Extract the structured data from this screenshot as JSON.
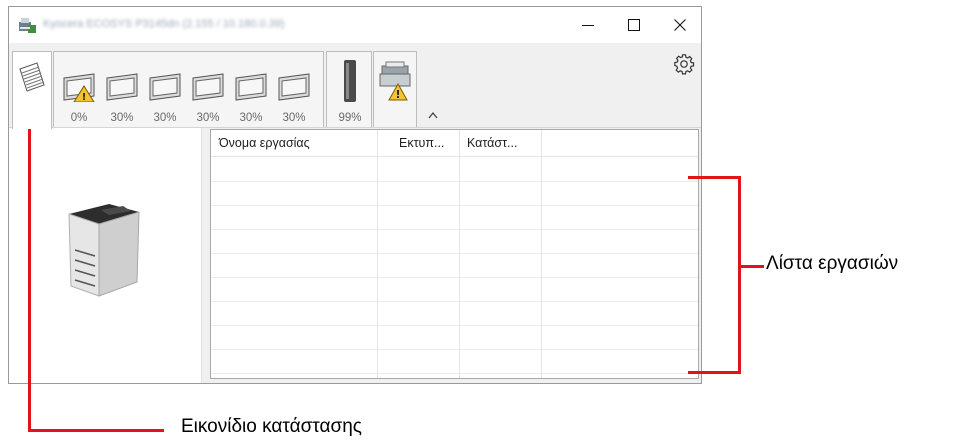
{
  "window": {
    "title_blurred": "Kyocera ECOSYS P3145dn (2.155 / 10.180.0.39)",
    "controls": {
      "minimize": "minimize",
      "maximize": "maximize",
      "close": "close"
    }
  },
  "toolbar": {
    "trays": [
      {
        "pct": "0%",
        "warning": true
      },
      {
        "pct": "30%",
        "warning": false
      },
      {
        "pct": "30%",
        "warning": false
      },
      {
        "pct": "30%",
        "warning": false
      },
      {
        "pct": "30%",
        "warning": false
      },
      {
        "pct": "30%",
        "warning": false
      }
    ],
    "toner": {
      "pct": "99%"
    },
    "colors": {
      "warning": "#f4c430",
      "tab_border": "#bdbdbd"
    }
  },
  "joblist": {
    "columns": [
      "Όνομα εργασίας",
      "Εκτυπ...",
      "Κατάστ..."
    ],
    "row_count": 9
  },
  "annotations": {
    "job_list_label": "Λίστα εργασιών",
    "status_icon_label": "Εικονίδιο κατάστασης",
    "color": "#e1131b"
  }
}
